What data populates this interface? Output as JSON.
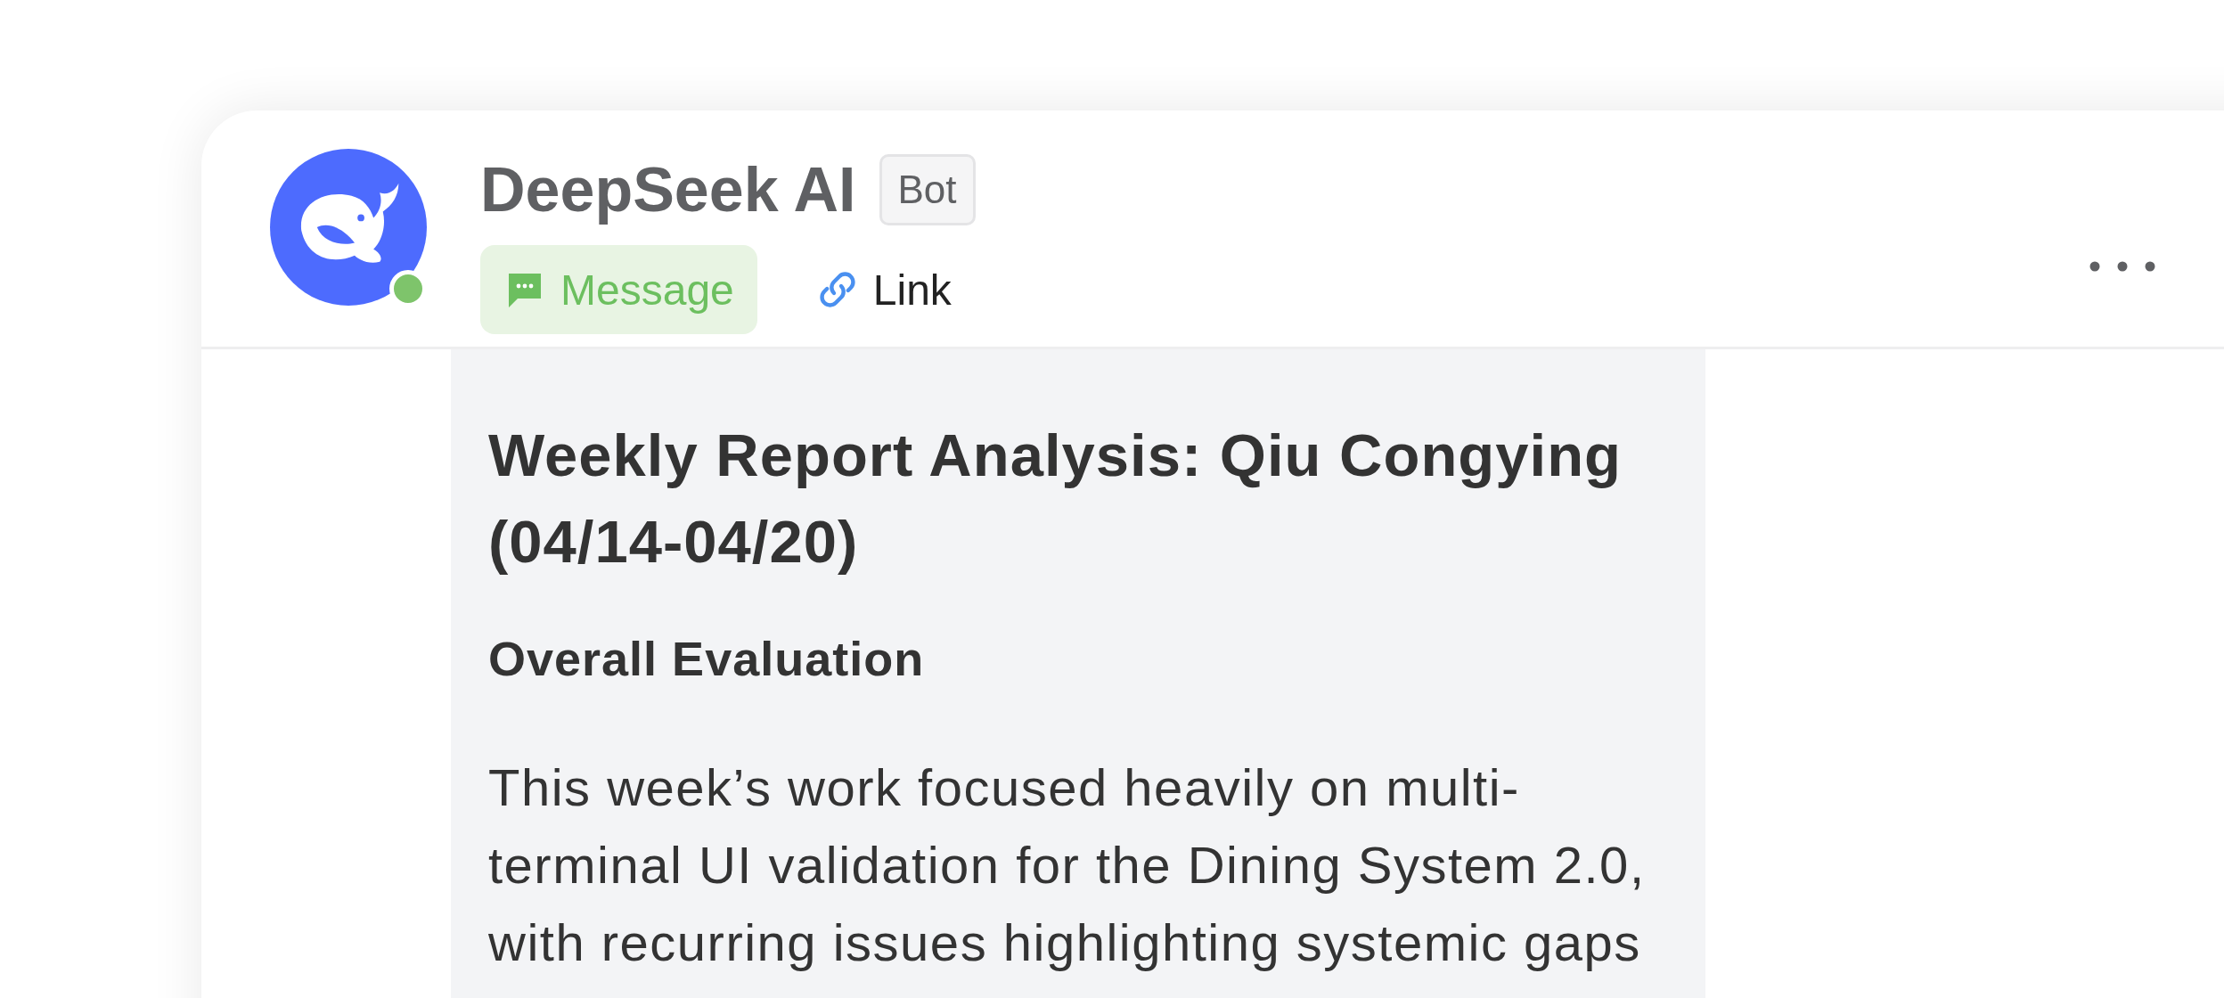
{
  "profile": {
    "name": "DeepSeek AI",
    "badge": "Bot",
    "online": true,
    "actions": [
      {
        "kind": "message",
        "label": "Message",
        "selected": true
      },
      {
        "kind": "link",
        "label": "Link",
        "selected": false
      }
    ]
  },
  "message": {
    "title": "Weekly Report Analysis: Qiu Congying (04/14-04/20)",
    "heading": "Overall Evaluation",
    "paragraph": "This week’s work focused heavily on multi-terminal UI validation for the Dining System 2.0, with recurring issues highlighting systemic gaps"
  }
}
